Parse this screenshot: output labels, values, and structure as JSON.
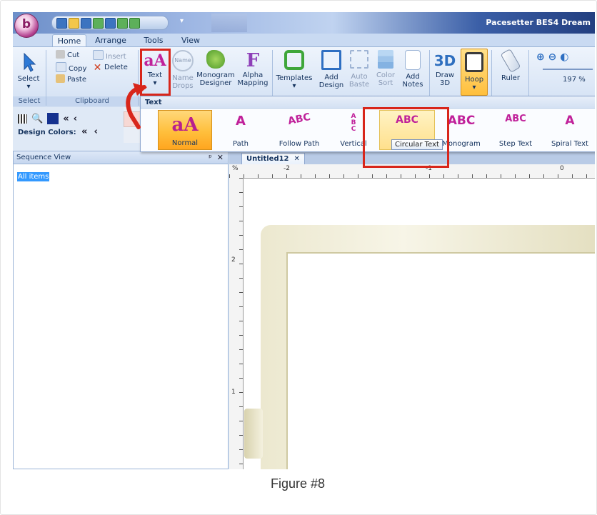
{
  "window": {
    "app_title": "Pacesetter BES4 Dream"
  },
  "tabs": [
    "Home",
    "Arrange",
    "Tools",
    "View"
  ],
  "ribbon": {
    "select_label": "Select",
    "cut_label": "Cut",
    "copy_label": "Copy",
    "paste_label": "Paste",
    "insert_label": "Insert",
    "delete_label": "Delete",
    "text_label": "Text",
    "name_drops_label": [
      "Name",
      "Drops"
    ],
    "monogram_designer_label": [
      "Monogram",
      "Designer"
    ],
    "alpha_mapping_label": [
      "Alpha",
      "Mapping"
    ],
    "templates_label": "Templates",
    "add_design_label": [
      "Add",
      "Design"
    ],
    "auto_baste_label": [
      "Auto",
      "Baste"
    ],
    "color_sort_label": [
      "Color",
      "Sort"
    ],
    "add_notes_label": [
      "Add",
      "Notes"
    ],
    "draw_3d_label": [
      "Draw",
      "3D"
    ],
    "draw_3d_icon_text": "3D",
    "hoop_label": "Hoop",
    "ruler_label": "Ruler",
    "zoom_value": "197 %",
    "name_icon_text": "Name",
    "groups": {
      "select": "Select",
      "clipboard": "Clipboard"
    }
  },
  "design_colors_label": "Design Colors:",
  "text_gallery": {
    "header": "Text",
    "items": [
      {
        "label": "Normal",
        "glyph": "aA"
      },
      {
        "label": "Path",
        "glyph": "A"
      },
      {
        "label": "Follow Path",
        "glyph": "ABC"
      },
      {
        "label": "Vertical",
        "glyph": "ABC"
      },
      {
        "label": "Circle",
        "glyph": "ABC"
      },
      {
        "label": "Monogram",
        "glyph": "ABC"
      },
      {
        "label": "Step Text",
        "glyph": "ABC"
      },
      {
        "label": "Spiral Text",
        "glyph": "A"
      }
    ],
    "tooltip": "Circular Text"
  },
  "sequence_view": {
    "title": "Sequence View",
    "pin": "ᵖ",
    "close": "✕",
    "item": "All items"
  },
  "document": {
    "tab_title": "Untitled12",
    "tab_close": "✕",
    "ruler_top": [
      "-2",
      "-1",
      "0"
    ],
    "ruler_left": [
      "2",
      "1"
    ]
  },
  "caption": "Figure #8",
  "colors": {
    "highlight": "#d8261b",
    "selected_item": "#ffbf3c",
    "brand_magenta": "#c0219a"
  }
}
